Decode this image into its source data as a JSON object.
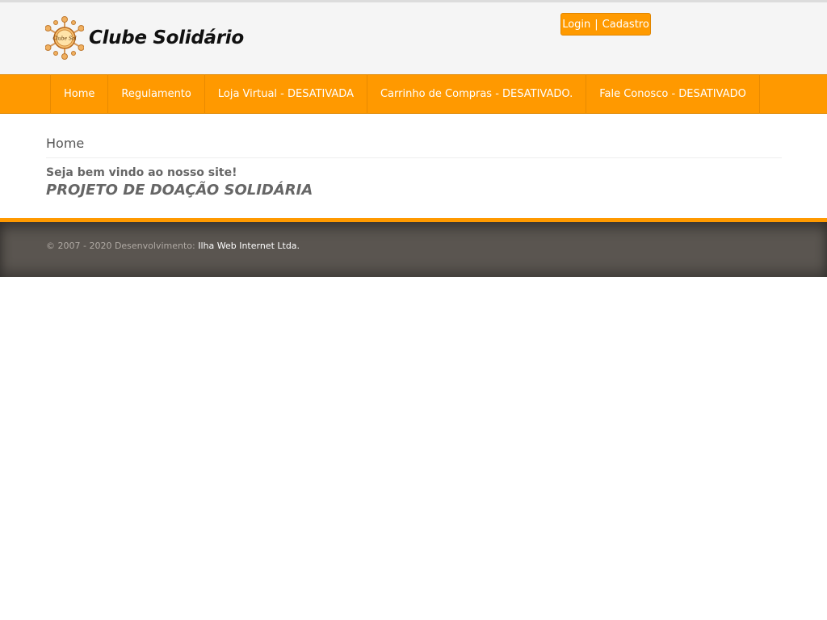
{
  "header": {
    "logo_text": "Clube Solidário",
    "logo_badge": "Clube Sol",
    "login_label": "Login",
    "separator": "|",
    "register_label": "Cadastro",
    "accent_color": "#ff9900"
  },
  "nav": {
    "items": [
      {
        "label": "Home"
      },
      {
        "label": "Regulamento"
      },
      {
        "label": "Loja Virtual - DESATIVADA"
      },
      {
        "label": "Carrinho de Compras - DESATIVADO."
      },
      {
        "label": "Fale Conosco - DESATIVADO"
      }
    ]
  },
  "main": {
    "page_title": "Home",
    "welcome": "Seja bem vindo ao nosso site!",
    "project_title": "PROJETO DE DOAÇÃO SOLIDÁRIA"
  },
  "footer": {
    "copyright": "© 2007 - 2020 Desenvolvimento:",
    "company": "Ilha Web Internet Ltda."
  }
}
